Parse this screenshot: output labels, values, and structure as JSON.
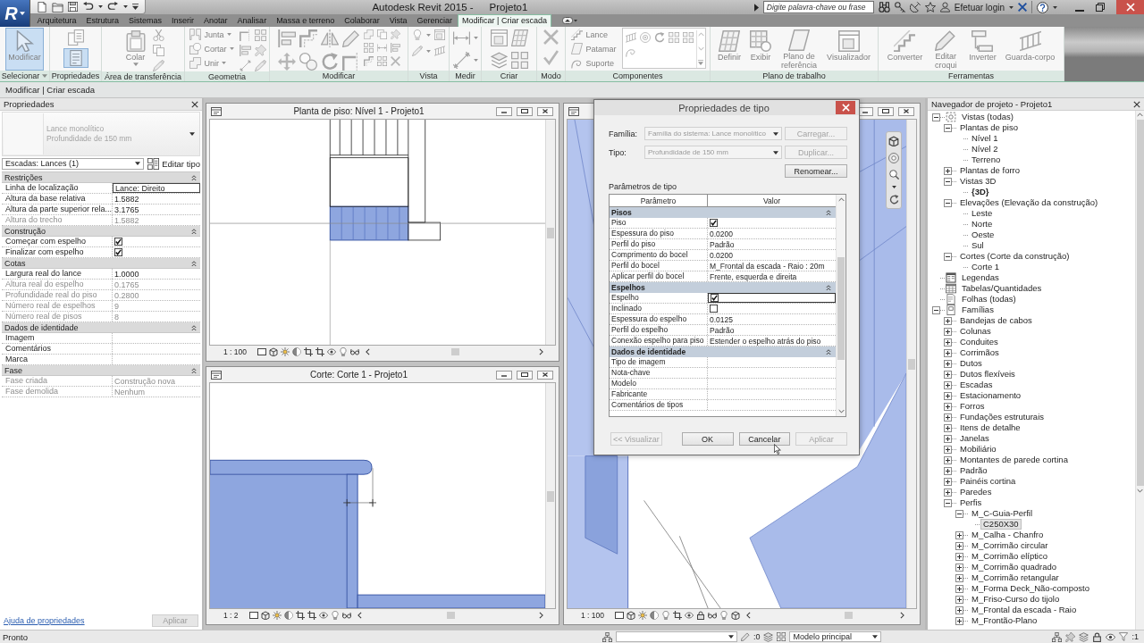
{
  "app_menu": {
    "label": "R"
  },
  "window": {
    "title": "Autodesk Revit 2015 -",
    "project": "Projeto1"
  },
  "infocenter": {
    "search": {
      "placeholder": "Digite palavra-chave ou frase"
    },
    "login": "Efetuar login"
  },
  "tabs": [
    {
      "label": "Arquitetura",
      "selected": false
    },
    {
      "label": "Estrutura",
      "selected": false
    },
    {
      "label": "Sistemas",
      "selected": false
    },
    {
      "label": "Inserir",
      "selected": false
    },
    {
      "label": "Anotar",
      "selected": false
    },
    {
      "label": "Analisar",
      "selected": false
    },
    {
      "label": "Massa e terreno",
      "selected": false
    },
    {
      "label": "Colaborar",
      "selected": false
    },
    {
      "label": "Vista",
      "selected": false
    },
    {
      "label": "Gerenciar",
      "selected": false
    },
    {
      "label": "Modificar | Criar escada",
      "selected": true
    }
  ],
  "ribbon": {
    "disabled": true,
    "panels": [
      {
        "title": "Selecionar",
        "menu": true,
        "items": [
          {
            "kind": "large",
            "label": "Modificar",
            "selected": true
          }
        ]
      },
      {
        "title": "Propriedades",
        "items": [
          {
            "kind": "icon",
            "selected": false
          },
          {
            "kind": "icon",
            "selected": true
          }
        ]
      },
      {
        "title": "Área de transferência",
        "items": [
          {
            "kind": "large",
            "label": "Colar",
            "dropdown": true
          }
        ]
      },
      {
        "title": "Geometria",
        "items": [
          {
            "kind": "small",
            "label": "Junta",
            "dropdown": true
          },
          {
            "kind": "small",
            "label": "Cortar",
            "dropdown": true
          },
          {
            "kind": "small",
            "label": "Unir",
            "dropdown": true
          }
        ]
      },
      {
        "title": "Modificar"
      },
      {
        "title": "Vista"
      },
      {
        "title": "Medir"
      },
      {
        "title": "Criar"
      },
      {
        "title": "Modo"
      },
      {
        "title": "Componentes",
        "items": [
          {
            "kind": "small",
            "label": "Lance"
          },
          {
            "kind": "small",
            "label": "Patamar"
          },
          {
            "kind": "small",
            "label": "Suporte"
          }
        ]
      },
      {
        "title": "Plano de trabalho",
        "items": [
          {
            "kind": "large",
            "label": "Definir"
          },
          {
            "kind": "large",
            "label": "Exibir"
          },
          {
            "kind": "large",
            "label": "Plano de referência"
          },
          {
            "kind": "large",
            "label": "Visualizador"
          }
        ]
      },
      {
        "title": "Ferramentas",
        "items": [
          {
            "kind": "large",
            "label": "Converter"
          },
          {
            "kind": "large",
            "label": "Editar croqui"
          },
          {
            "kind": "large",
            "label": "Inverter"
          },
          {
            "kind": "large",
            "label": "Guarda-corpo"
          }
        ]
      }
    ]
  },
  "options_bar": {
    "text": "Modificar | Criar escada"
  },
  "properties": {
    "title": "Propriedades",
    "type": {
      "family": "Lance monolítico",
      "name": "Profundidade de 150 mm"
    },
    "filter": "Escadas: Lances (1)",
    "edit_type": "Editar tipo",
    "groups": [
      {
        "name": "Restrições",
        "rows": [
          {
            "kind": "text",
            "name": "Linha de localização",
            "value": "Lance: Direito",
            "disabled": false,
            "selected": true
          },
          {
            "kind": "text",
            "name": "Altura da base relativa",
            "value": "1.5882",
            "disabled": false,
            "selected": false
          },
          {
            "kind": "text",
            "name": "Altura da parte superior rela...",
            "value": "3.1765",
            "disabled": false,
            "selected": false
          },
          {
            "kind": "text",
            "name": "Altura do trecho",
            "value": "1.5882",
            "disabled": true,
            "selected": false
          }
        ]
      },
      {
        "name": "Construção",
        "rows": [
          {
            "kind": "checkbox",
            "name": "Começar com espelho",
            "checked": true,
            "disabled": false,
            "selected": false
          },
          {
            "kind": "checkbox",
            "name": "Finalizar com espelho",
            "checked": true,
            "disabled": false,
            "selected": false
          }
        ]
      },
      {
        "name": "Cotas",
        "rows": [
          {
            "kind": "text",
            "name": "Largura real do lance",
            "value": "1.0000",
            "disabled": false,
            "selected": false
          },
          {
            "kind": "text",
            "name": "Altura real do espelho",
            "value": "0.1765",
            "disabled": true,
            "selected": false
          },
          {
            "kind": "text",
            "name": "Profundidade real do piso",
            "value": "0.2800",
            "disabled": true,
            "selected": false
          },
          {
            "kind": "text",
            "name": "Número real de espelhos",
            "value": "9",
            "disabled": true,
            "selected": false
          },
          {
            "kind": "text",
            "name": "Número real de pisos",
            "value": "8",
            "disabled": true,
            "selected": false
          }
        ]
      },
      {
        "name": "Dados de identidade",
        "rows": [
          {
            "kind": "text",
            "name": "Imagem",
            "disabled": false,
            "selected": false
          },
          {
            "kind": "text",
            "name": "Comentários",
            "disabled": false,
            "selected": false
          },
          {
            "kind": "text",
            "name": "Marca",
            "disabled": false,
            "selected": false
          }
        ]
      },
      {
        "name": "Fase",
        "rows": [
          {
            "kind": "text",
            "name": "Fase criada",
            "value": "Construção nova",
            "disabled": true,
            "selected": false
          },
          {
            "kind": "text",
            "name": "Fase demolida",
            "value": "Nenhum",
            "disabled": true,
            "selected": false
          }
        ]
      }
    ],
    "help_link": "Ajuda de propriedades",
    "apply": {
      "label": "Aplicar",
      "disabled": true
    }
  },
  "views": [
    {
      "kind": "plan",
      "title": "Planta de piso: Nível 1 - Projeto1",
      "scale": "1 : 100"
    },
    {
      "kind": "section",
      "title": "Corte: Corte 1 - Projeto1",
      "scale": "1 : 2"
    },
    {
      "kind": "model",
      "scale": "1 : 100"
    }
  ],
  "type_dialog": {
    "title": "Propriedades de tipo",
    "family": {
      "label": "Família:",
      "value": "Família do sistema: Lance monolítico",
      "disabled": true
    },
    "type": {
      "label": "Tipo:",
      "value": "Profundidade de 150 mm",
      "disabled": true
    },
    "side_buttons": [
      {
        "label": "Carregar...",
        "disabled": true
      },
      {
        "label": "Duplicar...",
        "disabled": true
      },
      {
        "label": "Renomear...",
        "disabled": false
      }
    ],
    "section_label": "Parâmetros de tipo",
    "columns": [
      "Parâmetro",
      "Valor"
    ],
    "groups": [
      {
        "name": "Pisos",
        "rows": [
          {
            "kind": "checkbox",
            "name": "Piso",
            "checked": true,
            "selected": false
          },
          {
            "kind": "text",
            "name": "Espessura do piso",
            "value": "0.0200",
            "selected": false
          },
          {
            "kind": "text",
            "name": "Perfil do piso",
            "value": "Padrão",
            "selected": false
          },
          {
            "kind": "text",
            "name": "Comprimento do bocel",
            "value": "0.0200",
            "selected": false
          },
          {
            "kind": "text",
            "name": "Perfil do bocel",
            "value": "M_Frontal da escada - Raio : 20m",
            "selected": false
          },
          {
            "kind": "text",
            "name": "Aplicar perfil do bocel",
            "value": "Frente, esquerda e direita",
            "selected": false
          }
        ]
      },
      {
        "name": "Espelhos",
        "rows": [
          {
            "kind": "checkbox",
            "name": "Espelho",
            "checked": true,
            "selected": true
          },
          {
            "kind": "checkbox",
            "name": "Inclinado",
            "checked": false,
            "selected": false
          },
          {
            "kind": "text",
            "name": "Espessura do espelho",
            "value": "0.0125",
            "selected": false
          },
          {
            "kind": "text",
            "name": "Perfil do espelho",
            "value": "Padrão",
            "selected": false
          },
          {
            "kind": "text",
            "name": "Conexão espelho para piso",
            "value": "Estender o espelho atrás do piso",
            "selected": false
          }
        ]
      },
      {
        "name": "Dados de identidade",
        "rows": [
          {
            "kind": "text",
            "name": "Tipo de imagem",
            "selected": false
          },
          {
            "kind": "text",
            "name": "Nota-chave",
            "selected": false
          },
          {
            "kind": "text",
            "name": "Modelo",
            "selected": false
          },
          {
            "kind": "text",
            "name": "Fabricante",
            "selected": false
          },
          {
            "kind": "text",
            "name": "Comentários de tipos",
            "selected": false
          }
        ]
      }
    ],
    "buttons": [
      {
        "label": "<< Visualizar",
        "disabled": true
      },
      {
        "label": "OK",
        "disabled": false
      },
      {
        "label": "Cancelar",
        "disabled": false
      },
      {
        "label": "Aplicar",
        "disabled": true
      }
    ]
  },
  "project_browser": {
    "title": "Navegador de projeto - Projeto1",
    "tree": [
      {
        "label": "Vistas (todas)",
        "expanded": true,
        "selected": false,
        "children": [
          {
            "label": "Plantas de piso",
            "expanded": true,
            "selected": false,
            "children": [
              {
                "label": "Nível 1",
                "selected": false,
                "active": false
              },
              {
                "label": "Nível 2",
                "selected": false,
                "active": false
              },
              {
                "label": "Terreno",
                "selected": false,
                "active": false
              }
            ]
          },
          {
            "label": "Plantas de forro",
            "expanded": false,
            "selected": false
          },
          {
            "label": "Vistas 3D",
            "expanded": true,
            "selected": false,
            "children": [
              {
                "label": "{3D}",
                "selected": false,
                "active": true
              }
            ]
          },
          {
            "label": "Elevações (Elevação da construção)",
            "expanded": true,
            "selected": false,
            "children": [
              {
                "label": "Leste",
                "selected": false,
                "active": false
              },
              {
                "label": "Norte",
                "selected": false,
                "active": false
              },
              {
                "label": "Oeste",
                "selected": false,
                "active": false
              },
              {
                "label": "Sul",
                "selected": false,
                "active": false
              }
            ]
          },
          {
            "label": "Cortes (Corte da construção)",
            "expanded": true,
            "selected": false,
            "children": [
              {
                "label": "Corte 1",
                "selected": false,
                "active": false
              }
            ]
          }
        ]
      },
      {
        "label": "Legendas",
        "selected": false
      },
      {
        "label": "Tabelas/Quantidades",
        "selected": false
      },
      {
        "label": "Folhas (todas)",
        "selected": false
      },
      {
        "label": "Famílias",
        "expanded": true,
        "selected": false,
        "children": [
          {
            "label": "Bandejas de cabos",
            "expanded": false,
            "selected": false
          },
          {
            "label": "Colunas",
            "expanded": false,
            "selected": false
          },
          {
            "label": "Conduites",
            "expanded": false,
            "selected": false
          },
          {
            "label": "Corrimãos",
            "expanded": false,
            "selected": false
          },
          {
            "label": "Dutos",
            "expanded": false,
            "selected": false
          },
          {
            "label": "Dutos flexíveis",
            "expanded": false,
            "selected": false
          },
          {
            "label": "Escadas",
            "expanded": false,
            "selected": false
          },
          {
            "label": "Estacionamento",
            "expanded": false,
            "selected": false
          },
          {
            "label": "Forros",
            "expanded": false,
            "selected": false
          },
          {
            "label": "Fundações estruturais",
            "expanded": false,
            "selected": false
          },
          {
            "label": "Itens de detalhe",
            "expanded": false,
            "selected": false
          },
          {
            "label": "Janelas",
            "expanded": false,
            "selected": false
          },
          {
            "label": "Mobiliário",
            "expanded": false,
            "selected": false
          },
          {
            "label": "Montantes de parede cortina",
            "expanded": false,
            "selected": false
          },
          {
            "label": "Padrão",
            "expanded": false,
            "selected": false
          },
          {
            "label": "Painéis cortina",
            "expanded": false,
            "selected": false
          },
          {
            "label": "Paredes",
            "expanded": false,
            "selected": false
          },
          {
            "label": "Perfis",
            "expanded": true,
            "selected": false,
            "children": [
              {
                "label": "M_C-Guia-Perfil",
                "expanded": true,
                "selected": false,
                "children": [
                  {
                    "label": "C250X30",
                    "selected": true
                  }
                ]
              },
              {
                "label": "M_Calha - Chanfro",
                "expanded": false,
                "selected": false
              },
              {
                "label": "M_Corrimão circular",
                "expanded": false,
                "selected": false
              },
              {
                "label": "M_Corrimão elíptico",
                "expanded": false,
                "selected": false
              },
              {
                "label": "M_Corrimão quadrado",
                "expanded": false,
                "selected": false
              },
              {
                "label": "M_Corrimão retangular",
                "expanded": false,
                "selected": false
              },
              {
                "label": "M_Forma Deck_Não-composto",
                "expanded": false,
                "selected": false
              },
              {
                "label": "M_Friso-Curso do tijolo",
                "expanded": false,
                "selected": false
              },
              {
                "label": "M_Frontal da escada - Raio",
                "expanded": false,
                "selected": false
              },
              {
                "label": "M_Frontão-Plano",
                "expanded": false,
                "selected": false
              }
            ]
          }
        ]
      }
    ]
  },
  "status_bar": {
    "text": "Pronto",
    "editing_count": ":0",
    "model": "Modelo principal",
    "filter_count": ":1"
  }
}
